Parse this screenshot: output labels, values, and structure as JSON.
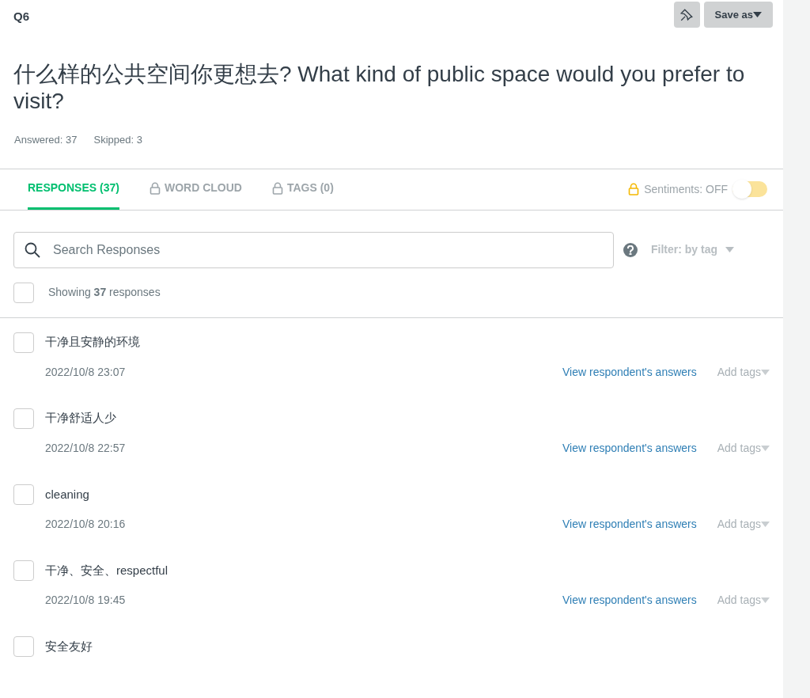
{
  "question": {
    "number": "Q6",
    "title": "什么样的公共空间你更想去?  What kind of public space would you prefer to visit?",
    "answered": "Answered: 37",
    "skipped": "Skipped: 3"
  },
  "toolbar": {
    "save_label": "Save as"
  },
  "tabs": [
    {
      "label": "RESPONSES (37)",
      "selected": true,
      "locked": false
    },
    {
      "label": "WORD CLOUD",
      "selected": false,
      "locked": true
    },
    {
      "label": "TAGS (0)",
      "selected": false,
      "locked": true
    }
  ],
  "sentiments": {
    "label": "Sentiments: OFF",
    "on": false
  },
  "search": {
    "placeholder": "Search Responses"
  },
  "filter": {
    "label": "Filter: by tag"
  },
  "summary": {
    "text": "Showing **37** responses",
    "checked": false
  },
  "responses": [
    {
      "text": "干净且安静的环境",
      "date": "2022/10/8 23:07",
      "link": "View respondent's answers",
      "tags": "Add tags",
      "checked": false
    },
    {
      "text": "干净舒适人少",
      "date": "2022/10/8 22:57",
      "link": "View respondent's answers",
      "tags": "Add tags",
      "checked": false
    },
    {
      "text": "cleaning",
      "date": "2022/10/8 20:16",
      "link": "View respondent's answers",
      "tags": "Add tags",
      "checked": false
    },
    {
      "text": "干净、安全、respectful",
      "date": "2022/10/8 19:45",
      "link": "View respondent's answers",
      "tags": "Add tags",
      "checked": false
    },
    {
      "text": "安全友好",
      "checked": false
    }
  ]
}
